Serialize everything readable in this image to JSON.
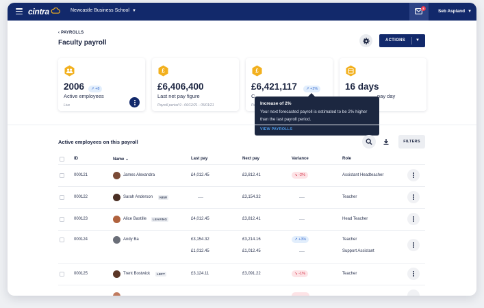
{
  "topbar": {
    "logo": "cintra",
    "school": "Newcastle Business School",
    "mail_badge": "8",
    "user": "Seb Aspland"
  },
  "header": {
    "breadcrumb": "‹ PAYROLLS",
    "title": "Faculty payroll",
    "actions_label": "ACTIONS"
  },
  "cards": [
    {
      "icon": "people-icon",
      "value": "2006",
      "chip": "+8",
      "label": "Active employees",
      "sub": "Live"
    },
    {
      "icon": "pound-icon",
      "value": "£6,406,400",
      "label": "Last net pay figure",
      "sub": "Payroll period 9 - 06/12/21 - 05/01/21"
    },
    {
      "icon": "pound-icon",
      "value": "£6,421,117",
      "chip": "+2%",
      "label": "C",
      "label_tail": "pay day",
      "sub": "Pe"
    },
    {
      "icon": "calendar-icon",
      "value": "16 days",
      "label": "pay day"
    }
  ],
  "tooltip": {
    "title": "Increase of 2%",
    "body": "Your next forecasted payroll is estimated to be 2% higher than the last payroll period.",
    "link": "VIEW PAYROLLS"
  },
  "table": {
    "title": "Active employees on this payroll",
    "filters_label": "FILTERS",
    "headers": {
      "id": "ID",
      "name": "Name",
      "last_pay": "Last pay",
      "next_pay": "Next pay",
      "variance": "Variance",
      "role": "Role"
    },
    "rows": [
      {
        "id": "000121",
        "name": "James Alexandra",
        "last": "£4,012.45",
        "next": "£3,812.41",
        "variance": "-2%",
        "role": "Assistant Headteacher"
      },
      {
        "id": "000122",
        "name": "Sarah Anderson",
        "tag": "NEW",
        "next": "£3,154.32",
        "role": "Teacher"
      },
      {
        "id": "000123",
        "name": "Alice Bastille",
        "tag": "LEAVING",
        "last": "£4,012.45",
        "next": "£3,812.41",
        "role": "Head Teacher"
      },
      {
        "id": "000124",
        "name": "Andy Ba",
        "last": "£3,154.32",
        "next": "£3,214.16",
        "variance": "+3%",
        "role": "Teacher",
        "last2": "£1,012.45",
        "next2": "£1,012.45",
        "role2": "Support Assistant"
      },
      {
        "id": "000125",
        "name": "Trent Bostwick",
        "tag": "LEFT",
        "last": "£3,124.11",
        "next": "£3,091.22",
        "variance": "-1%",
        "role": "Teacher"
      }
    ]
  },
  "colors": {
    "navy": "#12296b",
    "accent_yellow": "#f2b01e",
    "up": "#3b6ed0",
    "down": "#d23146",
    "link": "#4d9ae8"
  }
}
